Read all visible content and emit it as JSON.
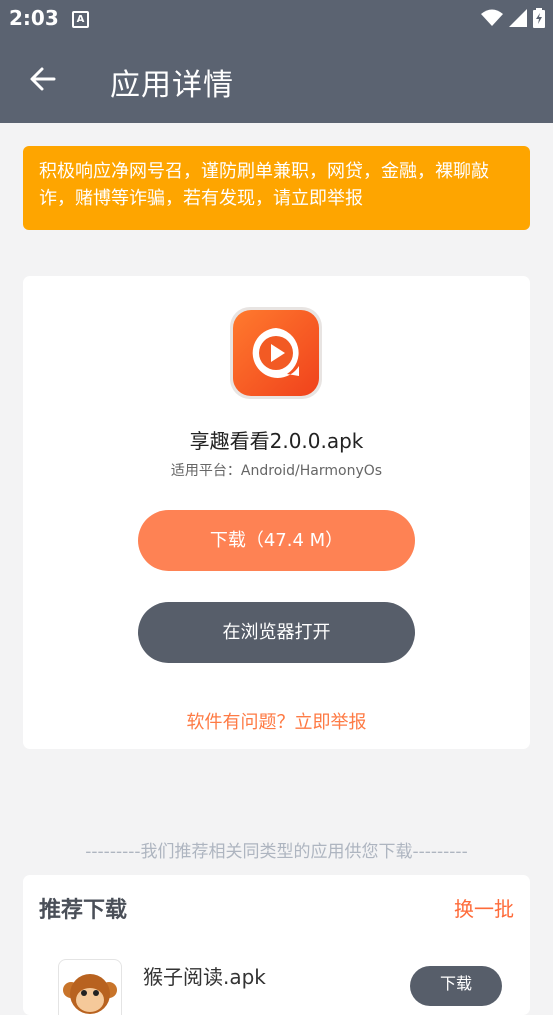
{
  "status_bar": {
    "time": "2:03",
    "notification_icon": "A"
  },
  "app_bar": {
    "title": "应用详情"
  },
  "notice": {
    "text": "积极响应净网号召，谨防刷单兼职，网贷，金融，裸聊敲诈，赌博等诈骗，若有发现，请立即举报"
  },
  "app": {
    "name": "享趣看看2.0.0.apk",
    "platform": "适用平台：Android/HarmonyOs",
    "download_label": "下载（47.4 M）",
    "browser_label": "在浏览器打开",
    "report_label": "软件有问题？立即举报"
  },
  "recommend": {
    "divider_text": "---------我们推荐相关同类型的应用供您下载---------",
    "title": "推荐下载",
    "refresh_label": "换一批",
    "items": [
      {
        "name": "猴子阅读.apk",
        "button": "下载"
      }
    ]
  },
  "colors": {
    "header": "#5b6371",
    "notice": "#fea500",
    "download": "#fe8254",
    "browser": "#575e6a",
    "accent": "#fe7a44"
  }
}
